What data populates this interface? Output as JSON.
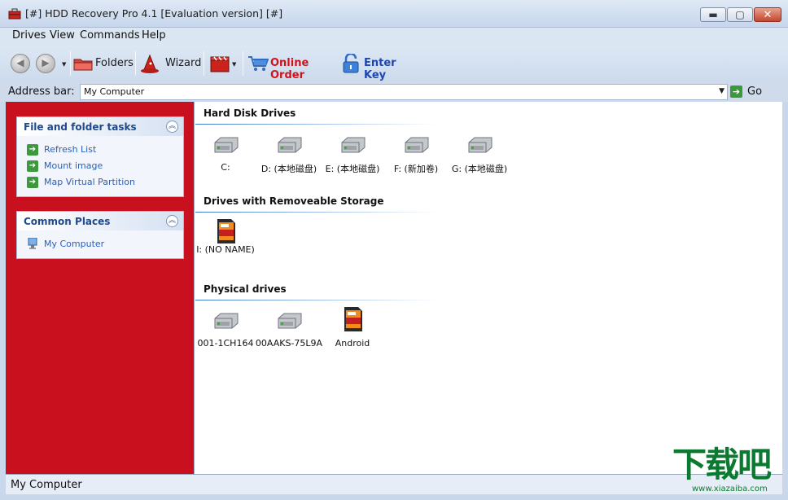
{
  "window": {
    "title": "[#] HDD Recovery Pro 4.1 [Evaluation version] [#]",
    "controls": {
      "minimize": "▬",
      "maximize": "▢",
      "close": "✕"
    }
  },
  "menu": [
    "Drives",
    "View",
    "Commands",
    "Help"
  ],
  "toolbar": {
    "back_icon": "back-arrow-icon",
    "forward_icon": "forward-arrow-icon",
    "folders_label": "Folders",
    "wizard_label": "Wizard",
    "online_order_label": "Online Order",
    "enter_key_label": "Enter Key",
    "order_color": "#d0141b",
    "key_color": "#1d46b1"
  },
  "address_bar": {
    "label": "Address bar:",
    "value": "My Computer",
    "go_label": "Go"
  },
  "left_pane": {
    "background": "#c8101f",
    "file_tasks": {
      "title": "File and folder tasks",
      "items": [
        "Refresh List",
        "Mount image",
        "Map Virtual Partition"
      ]
    },
    "common_places": {
      "title": "Common Places",
      "items": [
        "My Computer"
      ]
    }
  },
  "groups": {
    "hard_disks": {
      "title": "Hard Disk Drives",
      "drives": [
        "C:",
        "D: (本地磁盘)",
        "E: (本地磁盘)",
        "F: (新加卷)",
        "G: (本地磁盘)"
      ]
    },
    "removable": {
      "title": "Drives with Removeable Storage",
      "drives": [
        "I: (NO NAME)"
      ]
    },
    "physical": {
      "title": "Physical drives",
      "drives": [
        "001-1CH164",
        "00AAKS-75L9A",
        "Android"
      ]
    }
  },
  "status_bar": {
    "text": "My Computer"
  },
  "watermark": {
    "big": "下载吧",
    "small": "www.xiazaiba.com"
  }
}
